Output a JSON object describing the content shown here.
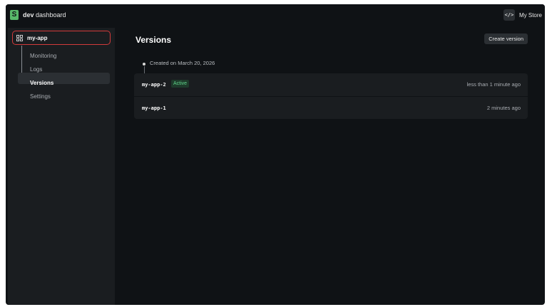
{
  "brand": {
    "name_bold": "dev",
    "name_rest": " dashboard",
    "logo_letter": "S"
  },
  "store": {
    "code_glyph": "</>",
    "label": "My Store"
  },
  "sidebar": {
    "app_name": "my-app",
    "items": [
      {
        "label": "Monitoring"
      },
      {
        "label": "Logs"
      },
      {
        "label": "Versions",
        "active": true
      },
      {
        "label": "Settings"
      }
    ]
  },
  "main": {
    "title": "Versions",
    "create_label": "Create version",
    "timeline_label": "Created on March 20, 2026",
    "versions": [
      {
        "name": "my-app-2",
        "badge": "Active",
        "time": "less than 1 minute ago"
      },
      {
        "name": "my-app-1",
        "badge": "",
        "time": "2 minutes ago"
      }
    ]
  },
  "colors": {
    "accent_red": "#d23b3b",
    "badge_green": "#5fd38a",
    "logo_green": "#58b86a"
  }
}
